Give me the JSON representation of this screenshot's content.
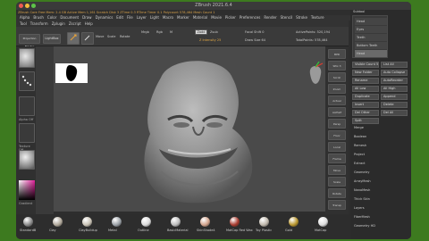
{
  "window": {
    "title": "ZBrush 2021.6.4",
    "info_line": "ZBrush Core  Free Mem: 2.4 GB  Active Mem 1,161  Scratch Disk 3  ZTime 0.3  RTime  Timer 0.1  Polycount 578,464  Mesh Count 1"
  },
  "menus": {
    "row1": [
      "Alpha",
      "Brush",
      "Color",
      "Document",
      "Draw",
      "Dynamics",
      "Edit",
      "File",
      "Layer",
      "Light",
      "Macro",
      "Marker",
      "Material",
      "Movie",
      "Picker",
      "Preferences",
      "Render",
      "Stencil",
      "Stroke",
      "Texture"
    ],
    "row2": [
      "Tool",
      "Transform",
      "Zplugin",
      "Zscript",
      "Help"
    ]
  },
  "toolbar": {
    "projection_master": "Projection Master",
    "lightbox": "LightBox",
    "edit": "Edit",
    "draw": "Draw",
    "move": "Move",
    "scale": "Scale",
    "rotate": "Rotate",
    "mrgb": "Mrgb",
    "rgb": "Rgb",
    "m": "M",
    "zadd": "Zadd",
    "zsub": "Zsub",
    "z_intensity": "Z Intensity 25",
    "focal_shift": "Focal Shift 0",
    "draw_size": "Draw Size 64",
    "rgb_intensity": "Rgb Intensity 100",
    "active_points": "ActivePoints: 520,194",
    "total_points": "TotalPoints: 578,464"
  },
  "left_shelf": {
    "slots": [
      "Brush",
      "Stroke",
      "Alpha Off",
      "Texture Off",
      "Material"
    ],
    "color_label": "Gradient",
    "switch_color": "SwitchColor"
  },
  "right_shelf": {
    "buttons": [
      "BPR",
      "SPix 3",
      "Scroll",
      "Zoom",
      "Actual",
      "AAHalf",
      "Persp",
      "Floor",
      "Local",
      "Frame",
      "Move",
      "Scale",
      "Rotate",
      "Transp"
    ]
  },
  "tray": {
    "header": "Subtool",
    "items": [
      "Visible Count 5",
      "List All",
      "New Folder",
      "Auto Collapse",
      "Rename",
      "AutoReorder",
      "All Low",
      "All High",
      "Duplicate",
      "Append",
      "Insert",
      "Delete",
      "Del Other",
      "Del All",
      "Split",
      "Merge",
      "Boolean",
      "Remesh",
      "Project",
      "Extract",
      "Geometry",
      "ArrayMesh",
      "NanoMesh",
      "Thick Skin",
      "Layers",
      "FiberMesh",
      "Geometry HD"
    ],
    "subtool_names": [
      "Head",
      "Eyes",
      "Teeth",
      "Bottom Teeth",
      "Head"
    ]
  },
  "materials": {
    "items": [
      "StandardB",
      "Clay",
      "ClayBuildup",
      "Metal",
      "Outline",
      "BasicMaterial",
      "SkinShade4",
      "MatCap Red Wax",
      "Toy Plastic",
      "Gold",
      "MatCap"
    ],
    "colors": [
      "#8a8a8a",
      "#b0a89a",
      "#c8c2b4",
      "#9aa0a6",
      "#d9d9d9",
      "#bcbcbc",
      "#d2a38c",
      "#a83a2e",
      "#c0b8ac",
      "#b8962e",
      "#ddd"
    ]
  },
  "colors": {
    "desktop": "#3d7a1f",
    "window": "#2e2e2e",
    "accent": "#d9a24a",
    "viewport": "#4a4a4a"
  }
}
